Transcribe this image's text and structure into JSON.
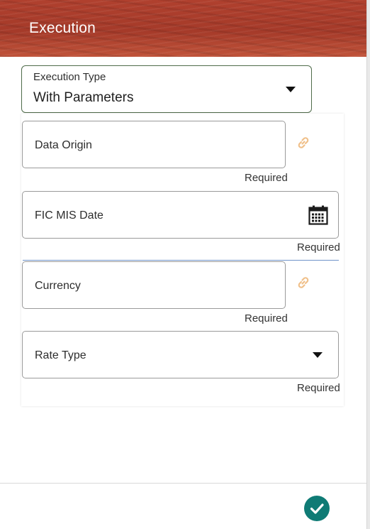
{
  "header": {
    "title": "Execution"
  },
  "execution_type": {
    "label": "Execution Type",
    "value": "With Parameters"
  },
  "fields": {
    "data_origin": {
      "label": "Data Origin",
      "required": "Required",
      "icon": "link-icon"
    },
    "fic_mis_date": {
      "label": "FIC MIS Date",
      "required": "Required",
      "icon": "calendar-icon"
    },
    "currency": {
      "label": "Currency",
      "required": "Required",
      "icon": "link-icon"
    },
    "rate_type": {
      "label": "Rate Type",
      "required": "Required",
      "icon": "chevron-down-icon"
    }
  },
  "footer": {
    "confirm_icon": "check-circle-icon"
  },
  "colors": {
    "header": "#a53a29",
    "link_icon": "#f0c08a",
    "confirm": "#0f7b75",
    "select_border": "#4f6b4a",
    "divider": "#6f93c9"
  }
}
